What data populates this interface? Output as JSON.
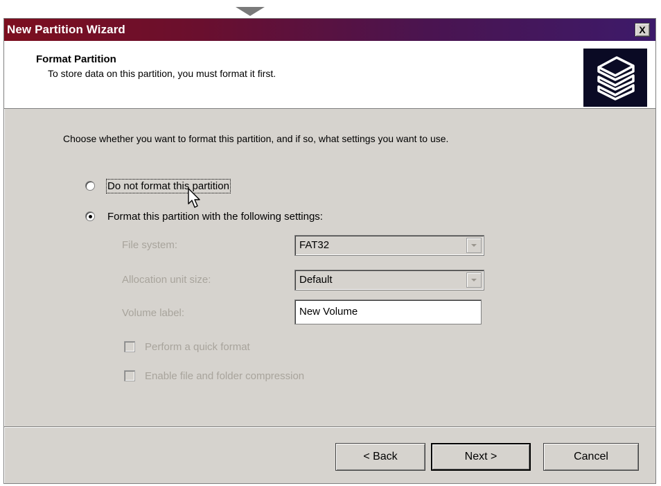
{
  "window": {
    "title": "New Partition Wizard",
    "close_glyph": "X"
  },
  "header": {
    "title": "Format Partition",
    "subtitle": "To store data on this partition, you must format it first.",
    "icon": "disk-stack-icon"
  },
  "instructions": "Choose whether you want to format this partition, and if so, what settings you want to use.",
  "options": {
    "no_format_label": "Do not format this partition",
    "no_format_selected": false,
    "format_label": "Format this partition with the following settings:",
    "format_selected": true
  },
  "settings": {
    "file_system_label": "File system:",
    "file_system_value": "FAT32",
    "allocation_label": "Allocation unit size:",
    "allocation_value": "Default",
    "volume_label_label": "Volume label:",
    "volume_label_value": "New Volume",
    "quick_format_label": "Perform a quick format",
    "quick_format_checked": false,
    "compression_label": "Enable file and folder compression",
    "compression_checked": false
  },
  "buttons": {
    "back": "< Back",
    "next": "Next >",
    "cancel": "Cancel"
  },
  "colors": {
    "title_gradient_start": "#7c0f1f",
    "title_gradient_end": "#3d1a6a",
    "dialog_face": "#d6d3ce",
    "disabled_text": "#a8a49c",
    "icon_background": "#0a0a24"
  }
}
